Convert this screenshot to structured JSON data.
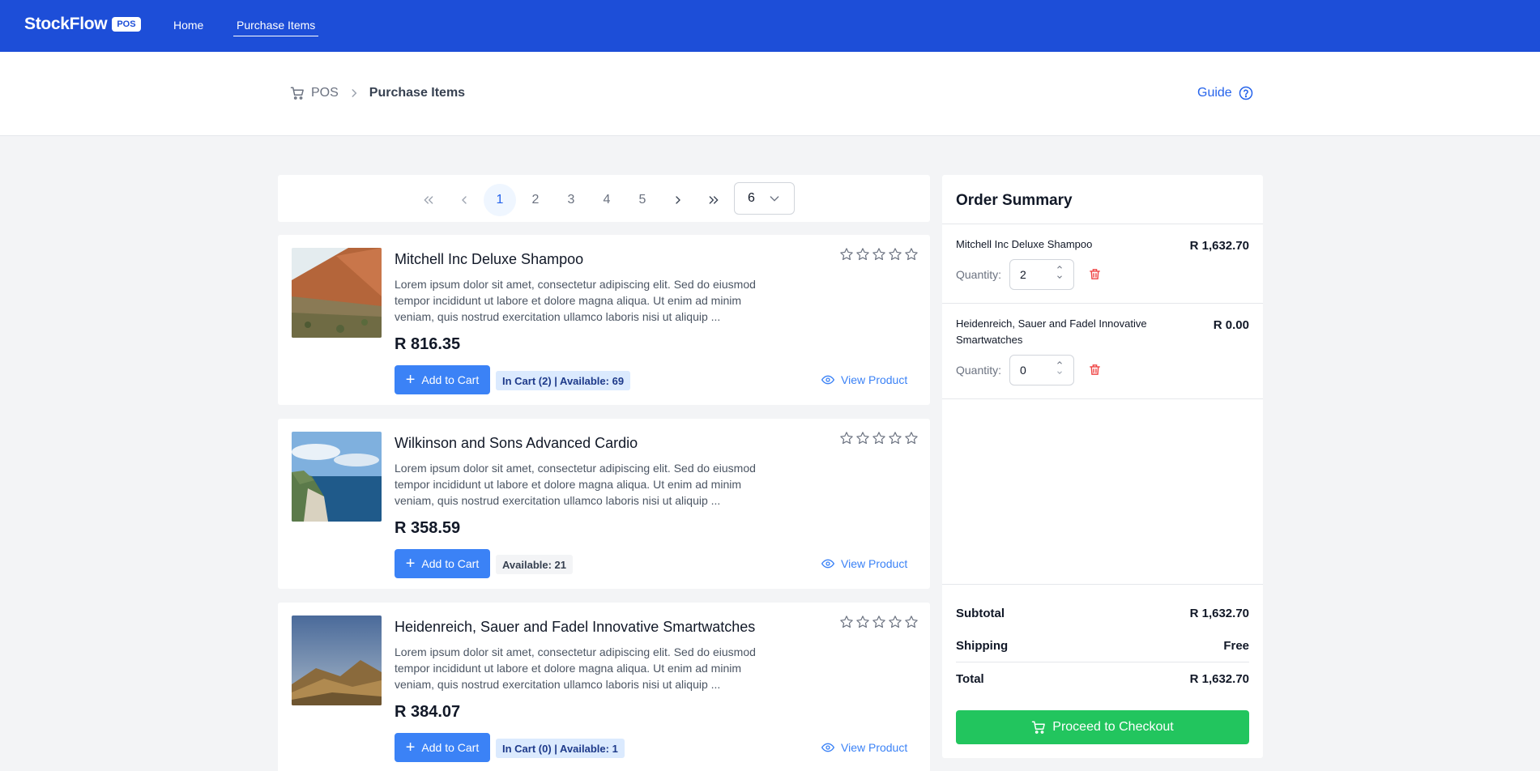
{
  "header": {
    "brand": "StockFlow",
    "brand_badge": "POS",
    "nav": [
      {
        "label": "Home"
      },
      {
        "label": "Purchase Items"
      }
    ]
  },
  "breadcrumb": {
    "root": "POS",
    "current": "Purchase Items",
    "guide_label": "Guide"
  },
  "pagination": {
    "pages": [
      "1",
      "2",
      "3",
      "4",
      "5"
    ],
    "current": "1",
    "per_page": "6"
  },
  "products": [
    {
      "name": "Mitchell Inc Deluxe Shampoo",
      "description": "Lorem ipsum dolor sit amet, consectetur adipiscing elit. Sed do eiusmod tempor incididunt ut labore et dolore magna aliqua. Ut enim ad minim veniam, quis nostrud exercitation ullamco laboris nisi ut aliquip ...",
      "price": "R 816.35",
      "add_label": "Add to Cart",
      "stock_label": "In Cart (2) | Available: 69",
      "view_label": "View Product",
      "rating": 0
    },
    {
      "name": "Wilkinson and Sons Advanced Cardio",
      "description": "Lorem ipsum dolor sit amet, consectetur adipiscing elit. Sed do eiusmod tempor incididunt ut labore et dolore magna aliqua. Ut enim ad minim veniam, quis nostrud exercitation ullamco laboris nisi ut aliquip ...",
      "price": "R 358.59",
      "add_label": "Add to Cart",
      "stock_label": "Available: 21",
      "view_label": "View Product",
      "rating": 0
    },
    {
      "name": "Heidenreich, Sauer and Fadel Innovative Smartwatches",
      "description": "Lorem ipsum dolor sit amet, consectetur adipiscing elit. Sed do eiusmod tempor incididunt ut labore et dolore magna aliqua. Ut enim ad minim veniam, quis nostrud exercitation ullamco laboris nisi ut aliquip ...",
      "price": "R 384.07",
      "add_label": "Add to Cart",
      "stock_label": "In Cart (0) | Available: 1",
      "view_label": "View Product",
      "rating": 0
    }
  ],
  "summary": {
    "title": "Order Summary",
    "quantity_label": "Quantity:",
    "items": [
      {
        "name": "Mitchell Inc Deluxe Shampoo",
        "price": "R 1,632.70",
        "quantity": "2"
      },
      {
        "name": "Heidenreich, Sauer and Fadel Innovative Smartwatches",
        "price": "R 0.00",
        "quantity": "0"
      }
    ],
    "subtotal_label": "Subtotal",
    "subtotal": "R 1,632.70",
    "shipping_label": "Shipping",
    "shipping": "Free",
    "total_label": "Total",
    "total": "R 1,632.70",
    "checkout_label": "Proceed to Checkout"
  },
  "colors": {
    "header": "#1d4ed8",
    "primary": "#3b82f6",
    "checkout": "#22c55e",
    "danger": "#ef4444"
  }
}
